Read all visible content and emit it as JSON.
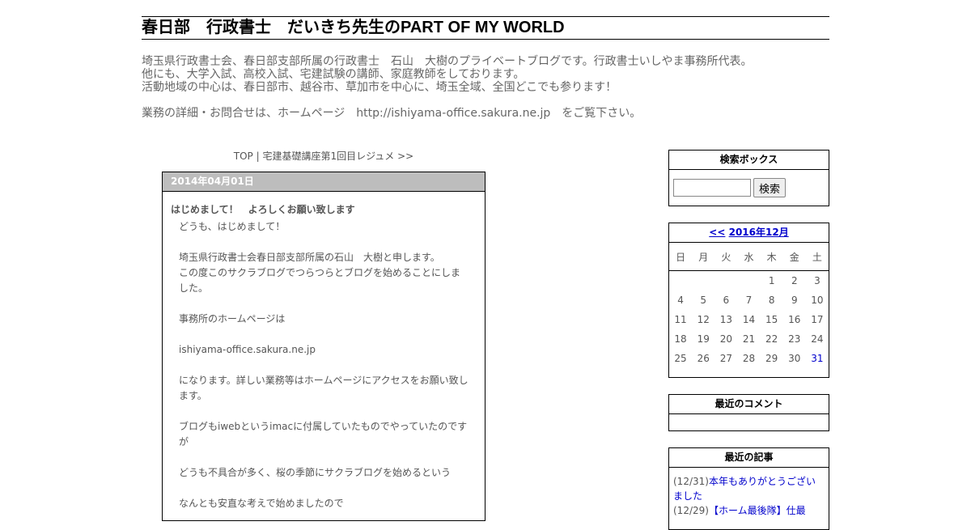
{
  "site": {
    "title": "春日部　行政書士　だいきち先生のPART OF MY WORLD",
    "desc_lines": [
      "埼玉県行政書士会、春日部支部所属の行政書士　石山　大樹のプライベートブログです。行政書士いしやま事務所代表。",
      "他にも、大学入試、高校入試、宅建試験の講師、家庭教師をしております。",
      "活動地域の中心は、春日部市、越谷市、草加市を中心に、埼玉全域、全国どこでも参ります！"
    ],
    "contact_line": "業務の詳細・お問合せは、ホームページ　http://ishiyama-office.sakura.ne.jp　をご覧下さい。"
  },
  "nav": {
    "top": "TOP",
    "sep": "|",
    "next": "宅建基礎講座第1回目レジュメ >>"
  },
  "entry": {
    "date": "2014年04月01日",
    "title": "はじめまして！　よろしくお願い致します",
    "body": [
      "どうも、はじめまして！",
      "",
      "埼玉県行政書士会春日部支部所属の石山　大樹と申します。",
      "この度このサクラブログでつらつらとブログを始めることにしました。",
      "",
      "事務所のホームページは",
      "",
      "ishiyama-office.sakura.ne.jp",
      "",
      "になります。詳しい業務等はホームページにアクセスをお願い致します。",
      "",
      "ブログもiwebというimacに付属していたものでやっていたのですが",
      "",
      "どうも不具合が多く、桜の季節にサクラブログを始めるという",
      "",
      "なんとも安直な考えで始めましたので"
    ]
  },
  "sidebar": {
    "search": {
      "heading": "検索ボックス",
      "placeholder": "",
      "button": "検索"
    },
    "calendar": {
      "prev": "<<",
      "month": "2016年12月",
      "dow": [
        "日",
        "月",
        "火",
        "水",
        "木",
        "金",
        "土"
      ],
      "weeks": [
        [
          "",
          "",
          "",
          "",
          "1",
          "2",
          "3"
        ],
        [
          "4",
          "5",
          "6",
          "7",
          "8",
          "9",
          "10"
        ],
        [
          "11",
          "12",
          "13",
          "14",
          "15",
          "16",
          "17"
        ],
        [
          "18",
          "19",
          "20",
          "21",
          "22",
          "23",
          "24"
        ],
        [
          "25",
          "26",
          "27",
          "28",
          "29",
          "30",
          "31"
        ]
      ],
      "linked_days": [
        "31"
      ]
    },
    "comments": {
      "heading": "最近のコメント"
    },
    "recent": {
      "heading": "最近の記事",
      "first_date": "(12/31)",
      "first_title": "本年もありがとうございました",
      "second_date": "(12/29)",
      "second_title": "【ホーム最後隊】仕最"
    }
  },
  "colors": {
    "link": "#0000cc",
    "date_bar": "#bdbdbd",
    "text": "#555555"
  }
}
